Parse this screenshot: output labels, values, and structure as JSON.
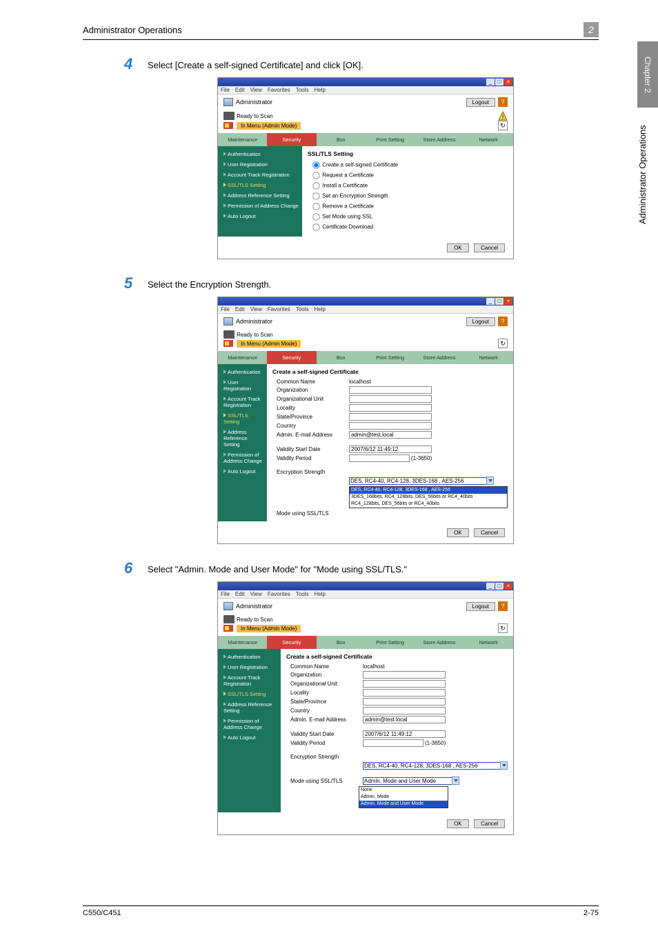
{
  "header": {
    "title": "Administrator Operations",
    "chapter_badge": "2"
  },
  "sidetab": {
    "chapter": "Chapter 2",
    "title": "Administrator Operations"
  },
  "steps": {
    "s4": {
      "num": "4",
      "text": "Select [Create a self-signed Certificate] and click [OK]."
    },
    "s5": {
      "num": "5",
      "text": "Select the Encryption Strength."
    },
    "s6": {
      "num": "6",
      "text": "Select \"Admin. Mode and User Mode\" for \"Mode using SSL/TLS.\""
    }
  },
  "browser_menu": [
    "File",
    "Edit",
    "View",
    "Favorites",
    "Tools",
    "Help"
  ],
  "admin_header": {
    "role": "Administrator",
    "logout": "Logout",
    "help": "?"
  },
  "status": {
    "ready": "Ready to Scan",
    "mode": "In Menu (Admin Mode)"
  },
  "tabs": [
    "Maintenance",
    "Security",
    "Box",
    "Print Setting",
    "Store Address",
    "Network"
  ],
  "sidebar_items": [
    "Authentication",
    "User Registration",
    "Account Track Registration",
    "SSL/TLS Setting",
    "Address Reference Setting",
    "Permission of Address Change",
    "Auto Logout"
  ],
  "screen1": {
    "title": "SSL/TLS Setting",
    "options": [
      "Create a self-signed Certificate",
      "Request a Certificate",
      "Install a Certificate",
      "Set an Encryption Strength",
      "Remove a Certificate",
      "Set Mode using SSL",
      "Certificate Download"
    ]
  },
  "form": {
    "title": "Create a self-signed Certificate",
    "common_name_lbl": "Common Name",
    "common_name_val": "localhost",
    "org_lbl": "Organization",
    "ou_lbl": "Organizational Unit",
    "locality_lbl": "Locality",
    "state_lbl": "State/Province",
    "country_lbl": "Country",
    "email_lbl": "Admin. E-mail Address",
    "email_val": "admin@test.local",
    "start_lbl": "Validity Start Date",
    "start_val": "2007/6/12 11:49:12",
    "period_lbl": "Validity Period",
    "period_suffix": "(1-3650)",
    "enc_lbl": "Encryption Strength",
    "enc_selected": "DES, RC4-40, RC4-128, 3DES-168 , AES-256",
    "enc_options": [
      "DES, RC4-40, RC4-128, 3DES-168 , AES-256",
      "3DES_168bits, RC4_128bits, DES_56bits or RC4_40bits",
      "RC4_128bits, DES_56bits or RC4_40bits"
    ],
    "mode_lbl": "Mode using SSL/TLS",
    "mode_selected": "Admin. Mode and User Mode",
    "mode_options": [
      "None",
      "Admin. Mode",
      "Admin. Mode and User Mode"
    ]
  },
  "buttons": {
    "ok": "OK",
    "cancel": "Cancel"
  },
  "footer": {
    "left": "C550/C451",
    "right": "2-75"
  }
}
